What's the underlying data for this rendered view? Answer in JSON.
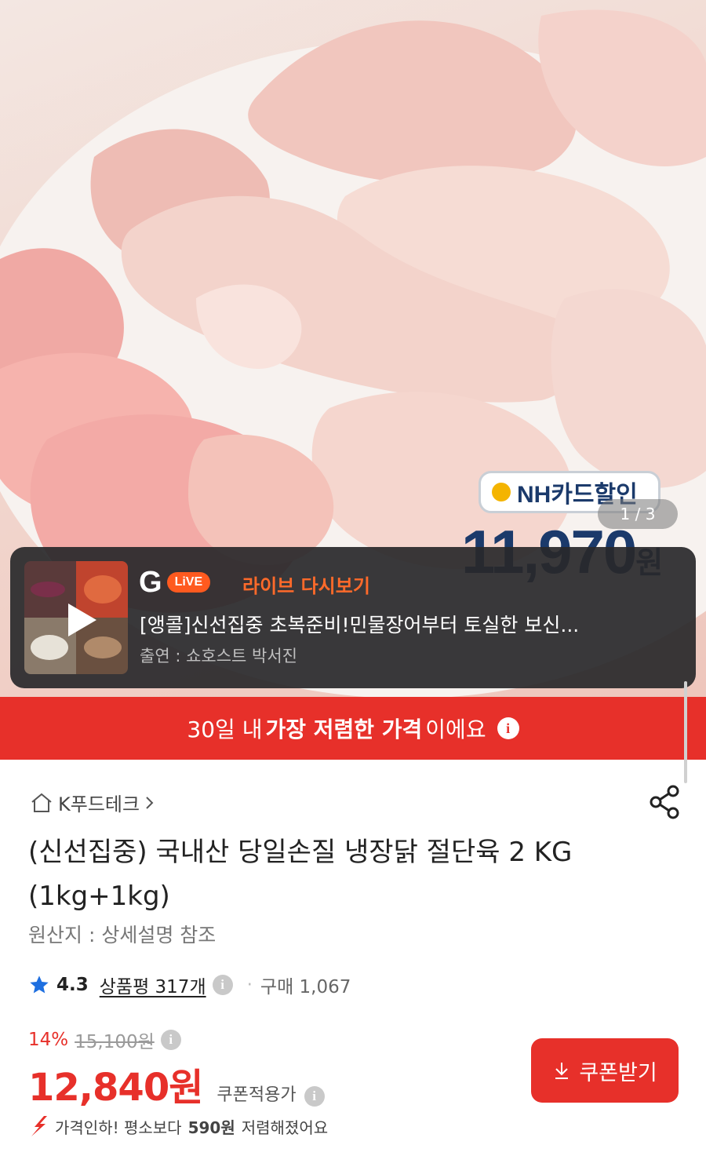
{
  "hero": {
    "nh_badge": "NH카드할인",
    "nh_price": "11,970",
    "nh_price_unit": "원",
    "page_indicator": "1 / 3"
  },
  "live": {
    "logo_letter": "G",
    "logo_pill": "LiVE",
    "replay_label": "라이브 다시보기",
    "title": "[앵콜]신선집중 초복준비!민물장어부터 토실한 보신...",
    "host": "출연 : 쇼호스트 박서진"
  },
  "banner": {
    "prefix": "30일 내 ",
    "highlight": "가장 저렴한 가격",
    "suffix": "이에요",
    "info_glyph": "i"
  },
  "product": {
    "store": "K푸드테크",
    "title": "(신선집중) 국내산 당일손질 냉장닭 절단육 2 KG (1kg+1kg)",
    "origin": "원산지 : 상세설명 참조",
    "rating": "4.3",
    "review_link": "상품평 317개",
    "purchase": "구매 1,067",
    "discount_pct": "14%",
    "original_price": "15,100",
    "original_unit": "원",
    "sale_price": "12,840원",
    "coupon_price_label": "쿠폰적용가",
    "coupon_button": "쿠폰받기",
    "price_drop_prefix": "가격인하! 평소보다 ",
    "price_drop_amount": "590원",
    "price_drop_suffix": " 저렴해졌어요"
  },
  "colors": {
    "accent_red": "#e7302a",
    "live_orange": "#ff6a2a",
    "star_blue": "#1e6fe0"
  }
}
